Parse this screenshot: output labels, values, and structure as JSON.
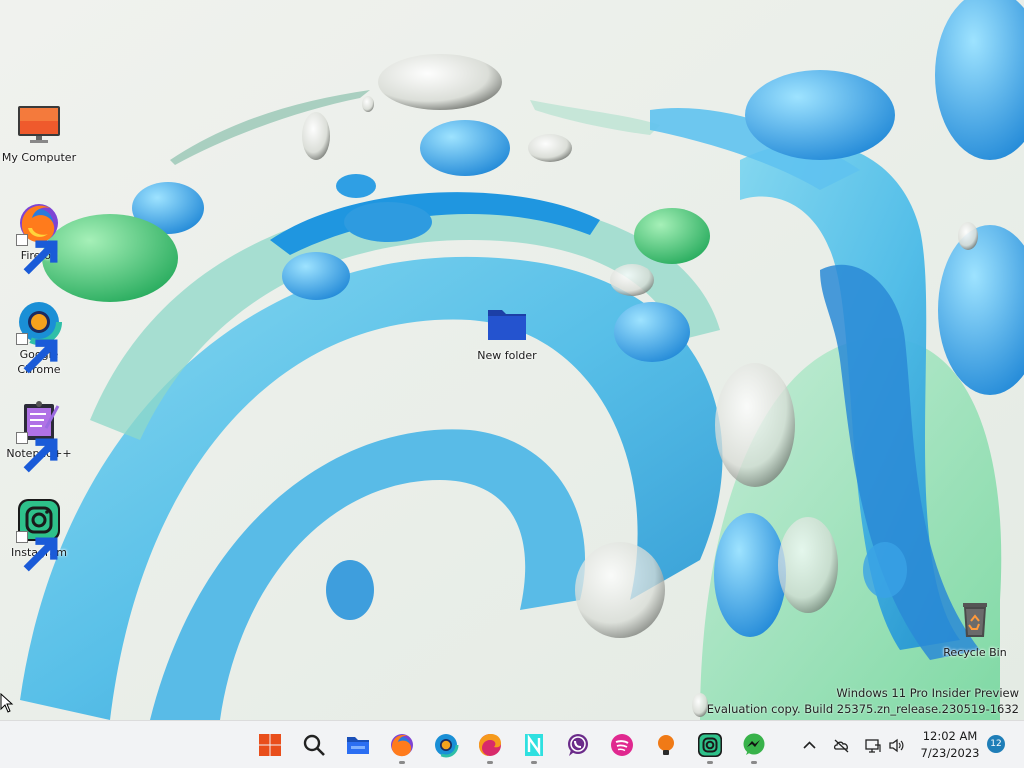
{
  "desktop": {
    "icons": [
      {
        "label": "My Computer",
        "icon": "monitor-icon",
        "shortcut": false
      },
      {
        "label": "Firefox",
        "icon": "firefox-icon",
        "shortcut": true
      },
      {
        "label": "Google Chrome",
        "icon": "chrome-icon",
        "shortcut": true
      },
      {
        "label": "Notepad++",
        "icon": "notepadpp-icon",
        "shortcut": true
      },
      {
        "label": "Instagram",
        "icon": "instagram-icon",
        "shortcut": true
      },
      {
        "label": "New folder",
        "icon": "folder-icon",
        "shortcut": false
      },
      {
        "label": "Recycle Bin",
        "icon": "recycle-bin-icon",
        "shortcut": false
      }
    ],
    "watermark": {
      "line1": "Windows 11 Pro Insider Preview",
      "line2": "Evaluation copy. Build 25375.zn_release.230519-1632"
    }
  },
  "taskbar": {
    "apps": [
      {
        "name": "Start",
        "icon": "windows-start-icon"
      },
      {
        "name": "Search",
        "icon": "search-icon"
      },
      {
        "name": "File Explorer",
        "icon": "file-explorer-icon"
      },
      {
        "name": "Firefox",
        "icon": "firefox-icon"
      },
      {
        "name": "Google Chrome",
        "icon": "chrome-icon"
      },
      {
        "name": "Microsoft Edge",
        "icon": "edge-icon"
      },
      {
        "name": "Notion",
        "icon": "notion-icon"
      },
      {
        "name": "WhatsApp",
        "icon": "whatsapp-icon"
      },
      {
        "name": "Spotify",
        "icon": "spotify-icon"
      },
      {
        "name": "Tips",
        "icon": "lightbulb-icon"
      },
      {
        "name": "Instagram",
        "icon": "instagram-icon"
      },
      {
        "name": "Messenger",
        "icon": "messenger-icon"
      }
    ],
    "tray": {
      "time": "12:02 AM",
      "date": "7/23/2023",
      "notification_count": "12"
    }
  },
  "colors": {
    "accent": "#0067c0",
    "taskbar_bg": "#f2f3f5"
  }
}
